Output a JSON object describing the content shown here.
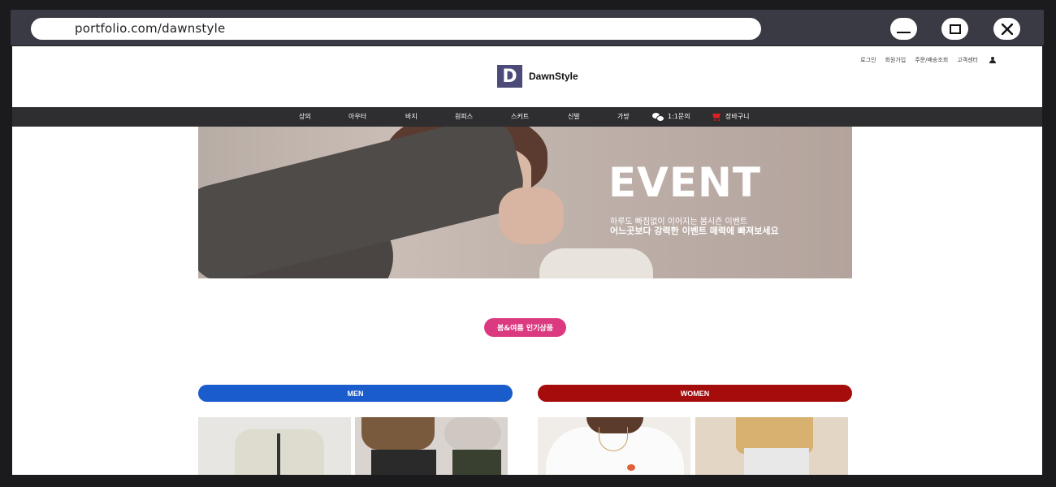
{
  "browser": {
    "url": "portfolio.com/dawnstyle"
  },
  "header": {
    "util_links": [
      "로그인",
      "회원가입",
      "주문/배송조회",
      "고객센터"
    ],
    "logo_letter": "D",
    "logo_text": "DawnStyle",
    "logo_color": "#4b4a78"
  },
  "nav": {
    "items": [
      "상의",
      "아우터",
      "바지",
      "원피스",
      "스커트",
      "신발",
      "가방"
    ],
    "inquiry_label": "1:1문의",
    "cart_label": "장바구니"
  },
  "banner": {
    "title": "EVENT",
    "subtitle_line1": "하루도 빠짐없이 이어지는 봄시즌 이벤트",
    "subtitle_line2": "어느곳보다 강력한 이벤트 매력에 빠져보세요"
  },
  "section": {
    "pill_label": "봄&여름 인기상품",
    "pill_color": "#dc3a80"
  },
  "categories": {
    "men_label": "MEN",
    "men_color": "#1a5ccc",
    "women_label": "WOMEN",
    "women_color": "#a50c0c"
  }
}
